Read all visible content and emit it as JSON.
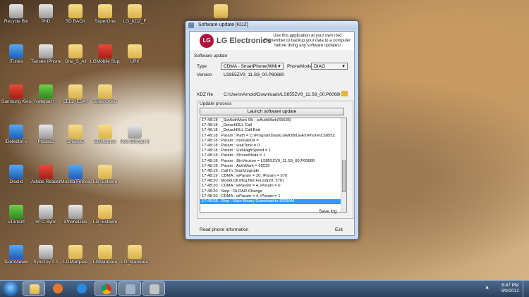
{
  "desktop": {
    "icons": [
      {
        "label": "Recycle Bin",
        "kind": "app-gray"
      },
      {
        "label": "PhD",
        "kind": "app-gray"
      },
      {
        "label": "SD BACK",
        "kind": "folder"
      },
      {
        "label": "SuperOne",
        "kind": "folder"
      },
      {
        "label": "LG_KDZ_F",
        "kind": "folder"
      },
      {
        "label": "",
        "kind": "folder"
      },
      {
        "label": "iTunes",
        "kind": "app-blue"
      },
      {
        "label": "Tansee iPhone Copy",
        "kind": "app-gray"
      },
      {
        "label": "One_S_All",
        "kind": "folder"
      },
      {
        "label": "LGMobile Support Tool",
        "kind": "app-red"
      },
      {
        "label": "UPK",
        "kind": "folder"
      },
      {
        "label": "Samsung Kies",
        "kind": "app-red"
      },
      {
        "label": "Notepad++",
        "kind": "app-green"
      },
      {
        "label": "CELL_EBAY",
        "kind": "folder"
      },
      {
        "label": "SuperOneC",
        "kind": "folder"
      },
      {
        "label": "iDetector-v",
        "kind": "app-blue"
      },
      {
        "label": "Picasa3",
        "kind": "app-gray"
      },
      {
        "label": "DriveLG",
        "kind": "folder"
      },
      {
        "label": "LGMarque",
        "kind": "folder"
      },
      {
        "label": "New Bitmap Image",
        "kind": "app-gray"
      },
      {
        "label": "Disclid",
        "kind": "app-blue"
      },
      {
        "label": "Adobe Reader X",
        "kind": "app-red"
      },
      {
        "label": "Mozilla Firefox",
        "kind": "app-blue"
      },
      {
        "label": "LG_Esteem",
        "kind": "folder"
      },
      {
        "label": "uTorrent",
        "kind": "app-green"
      },
      {
        "label": "HTC Sync",
        "kind": "app-gray"
      },
      {
        "label": "iPhoneDisk",
        "kind": "app-gray"
      },
      {
        "label": "LG_Esteem",
        "kind": "folder"
      },
      {
        "label": "TeamViewer",
        "kind": "app-blue"
      },
      {
        "label": "SyncToy 2.1",
        "kind": "app-gray"
      },
      {
        "label": "LGMarquee",
        "kind": "folder"
      },
      {
        "label": "LGMarquee",
        "kind": "folder"
      },
      {
        "label": "LG_Marquee",
        "kind": "folder"
      }
    ]
  },
  "window": {
    "title": "Software update [KDZ]",
    "brand": "LG Electronics",
    "brand_logo": "LG",
    "warning": "Use this application at your own risk! Remember to backup your data to a computer before doing any software updates!",
    "section_update": "Software update",
    "type_label": "Type",
    "type_value": "CDMA - SmartPhone(WM)",
    "phonemode_label": "PhoneMode",
    "phonemode_value": "DIAG",
    "version_label": "Version",
    "version_value": "LS855ZV9_11.S9_00.P60680",
    "kdz_label": "KDZ file",
    "kdz_value": "C:\\Users\\Arnold\\Downloads\\LS855ZV9_11.S9_00.P60680.kdz",
    "process_label": "Update process",
    "launch_label": "Launch software update",
    "log": [
      "17:48:18 : _SetAuthMark Ok : wAuthMark(65535)",
      "17:48:18 : _DetachDLL Call",
      "17:48:18 : _DetachDLL Call End",
      "17:48:18 : Param : Path = C:\\ProgramData\\LGMOBILEAX\\Phone\\LS855Z",
      "17:48:18 : Param : moduleDir =",
      "17:48:18 : Param : waitTime = 0",
      "17:48:18 : Param : UsbHighSpeed = 1",
      "17:48:18 : Param : PhoneMode = 1",
      "17:48:18 : Param : BinVersion = LS855ZV9_11.S9_00.P60680",
      "17:48:18 : Param : AuthMark = 65535",
      "17:48:19 : Call fn_StartUpgrade",
      "17:48:19 : CDMA : wParam = 20, lParam = 570",
      "17:48:20 : Model Dll Msg Not Found(20, 570)",
      "17:48:20 : CDMA : wParam = 4, lParam = 0",
      "17:48:20 : Step : DLOAD Change",
      "17:48:20 : CDMA : wParam = 4, lParam = 1",
      "17:49:38 : Step : Main Binary Download to SDRAM"
    ],
    "save_log": "Save log",
    "read_phone": "Read phone information",
    "exit": "Exit"
  },
  "taskbar": {
    "items": [
      "start-orb",
      "explorer",
      "media-player",
      "internet-explorer",
      "chrome",
      "software-update",
      "photo-app"
    ],
    "time": "6:47 PM",
    "date": "9/9/2012",
    "tray_arrow": "▲"
  }
}
